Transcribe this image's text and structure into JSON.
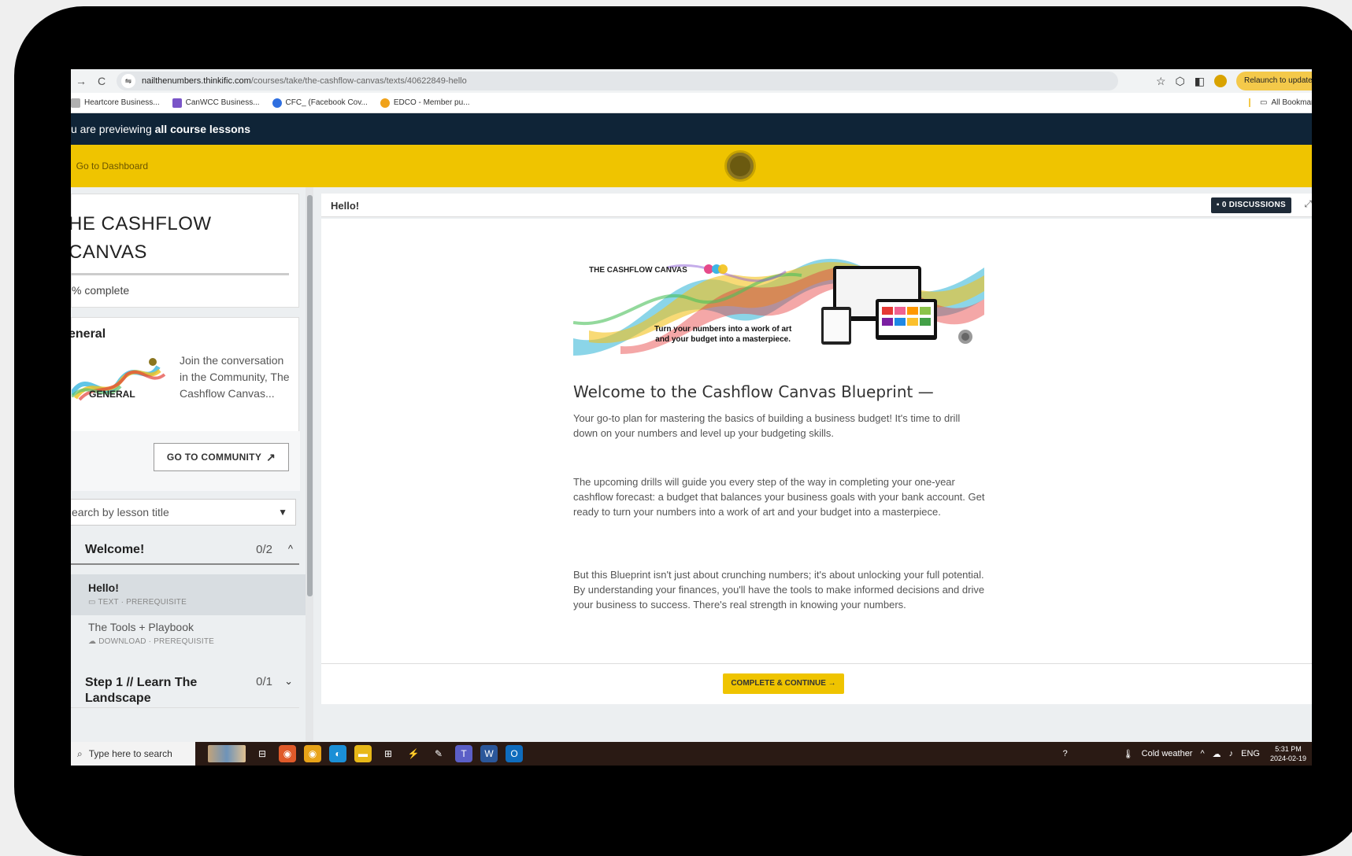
{
  "browser": {
    "url_host": "nailthenumbers.thinkific.com",
    "url_path": "/courses/take/the-cashflow-canvas/texts/40622849-hello",
    "relaunch_label": "Relaunch to update",
    "bookmarks": [
      {
        "label": "Heartcore Business...",
        "color": "#b0b0b0"
      },
      {
        "label": "CanWCC Business...",
        "color": "#7a55c8"
      },
      {
        "label": "CFC_ (Facebook Cov...",
        "color": "#2f6fe0"
      },
      {
        "label": "EDCO - Member pu...",
        "color": "#f0a21a"
      }
    ],
    "all_bookmarks": "All Bookmarks"
  },
  "preview_banner": {
    "prefix": "u are previewing",
    "bold": "all course lessons"
  },
  "header": {
    "go_to_dashboard": "Go to Dashboard"
  },
  "sidebar": {
    "course_title_line1": "HE CASHFLOW",
    "course_title_line2": "CANVAS",
    "progress_text": "% complete",
    "general": {
      "heading": "eneral",
      "image_label": "GENERAL",
      "description": "Join the conversation in the Community, The Cashflow Canvas...",
      "button": "GO TO COMMUNITY",
      "button_icon": "arrow-up-right-icon"
    },
    "search_placeholder": "earch by lesson title",
    "chapters": [
      {
        "number": ")",
        "title": "Welcome!",
        "count": "0/2",
        "chevron": "^"
      },
      {
        "number": ")",
        "title": "Step 1 // Learn The Landscape",
        "count": "0/1",
        "chevron": "⌄"
      }
    ],
    "lessons": [
      {
        "title": "Hello!",
        "meta": "TEXT · PREREQUISITE"
      },
      {
        "title": "The Tools + Playbook",
        "meta": "DOWNLOAD · PREREQUISITE"
      }
    ]
  },
  "main": {
    "lesson_title": "Hello!",
    "discussions": "0 DISCUSSIONS",
    "banner_brand": "THE CASHFLOW CANVAS",
    "banner_tagline_1": "Turn your numbers into a work of art",
    "banner_tagline_2": "and your budget into a masterpiece.",
    "heading": "Welcome to the Cashflow Canvas Blueprint —",
    "paragraphs": [
      "Your go-to plan for mastering the basics of building a business budget! It's time to drill down on your numbers and level up your budgeting skills.",
      "The upcoming drills will guide you every step of the way in completing your one-year cashflow forecast: a budget that balances your business goals with your bank account. Get ready to turn your numbers into a work of art and your budget into a masterpiece.",
      "But this Blueprint isn't just about crunching numbers; it's about unlocking your full potential. By understanding your finances, you'll have the tools to make informed decisions and drive your business to success. There's real strength in knowing your numbers."
    ],
    "complete_button": "COMPLETE & CONTINUE →"
  },
  "taskbar": {
    "search_placeholder": "Type here to search",
    "weather": "Cold weather",
    "language": "ENG",
    "time": "5:31 PM",
    "date": "2024-02-19"
  }
}
